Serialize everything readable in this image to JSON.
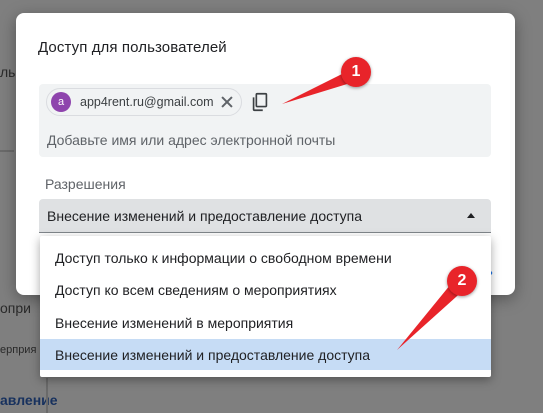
{
  "background": {
    "fragments": [
      "ль",
      "опри",
      "ерприя",
      "авление"
    ]
  },
  "dialog": {
    "title": "Доступ для пользователей",
    "chip": {
      "avatar_letter": "a",
      "email": "app4rent.ru@gmail.com"
    },
    "add_placeholder": "Добавьте имя или адрес электронной почты",
    "permissions_label": "Разрешения",
    "selected_permission": "Внесение изменений и предоставление доступа",
    "action_fragment": "ь"
  },
  "menu": {
    "options": [
      "Доступ только к информации о свободном времени",
      "Доступ ко всем сведениям о мероприятиях",
      "Внесение изменений в мероприятия",
      "Внесение изменений и предоставление доступа"
    ],
    "selected_index": 3
  },
  "annotations": {
    "markers": [
      "1",
      "2"
    ],
    "color": "#e8242a"
  },
  "colors": {
    "overlay": "#7f7f7f",
    "selected_row": "#c6dcf5",
    "avatar": "#8e44ad",
    "link": "#1a73e8"
  }
}
